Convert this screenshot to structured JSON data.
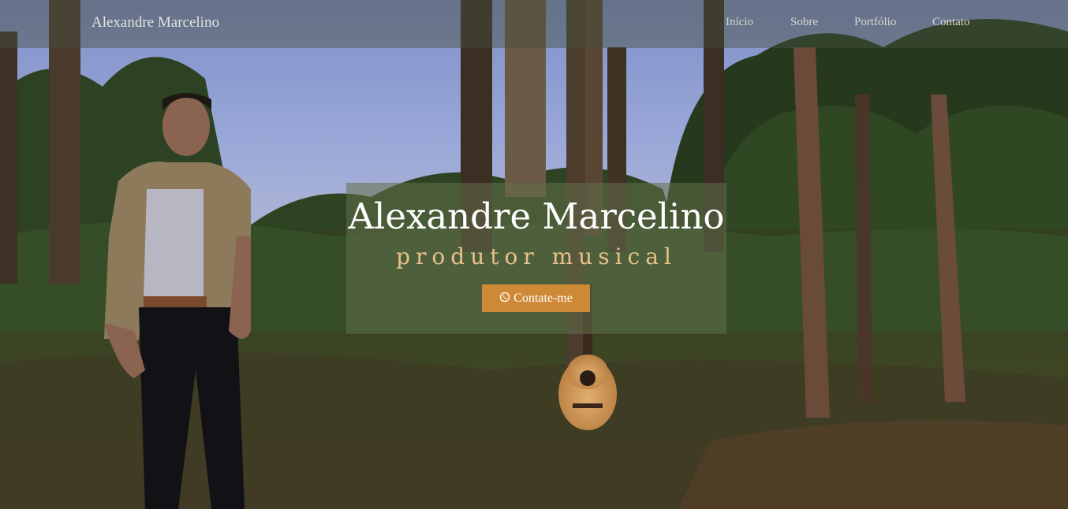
{
  "navbar": {
    "brand": "Alexandre Marcelino",
    "links": [
      "Início",
      "Sobre",
      "Portfólio",
      "Contato"
    ]
  },
  "hero": {
    "title": "Alexandre Marcelino",
    "subtitle": "produtor musical",
    "cta": {
      "icon": "whatsapp-icon",
      "label": "Contate-me"
    }
  },
  "colors": {
    "accent": "#cf8a38",
    "subtitle": "#e9c08a",
    "navbar_bg": "rgba(70,80,62,0.45)"
  }
}
